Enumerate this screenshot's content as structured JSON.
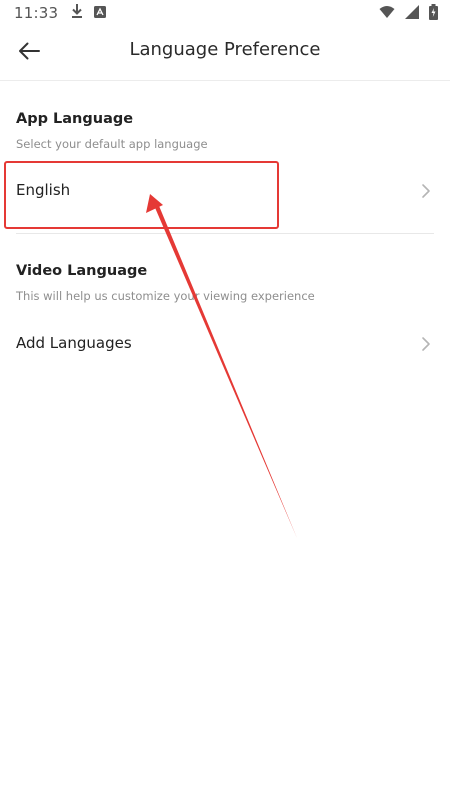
{
  "status_bar": {
    "time": "11:33",
    "icons": [
      "download-icon",
      "app-notification-icon",
      "wifi-icon",
      "signal-icon",
      "battery-icon"
    ]
  },
  "app_bar": {
    "title": "Language Preference",
    "back_icon": "back-arrow-icon"
  },
  "app_language": {
    "title": "App Language",
    "subtitle": "Select your default app language",
    "selected": "English"
  },
  "video_language": {
    "title": "Video Language",
    "subtitle": "This will help us customize your viewing experience",
    "add_label": "Add Languages"
  },
  "colors": {
    "annotation": "#e53935",
    "text_primary": "#222222",
    "text_secondary": "#8e8e8e",
    "divider": "#e8e8e8"
  }
}
